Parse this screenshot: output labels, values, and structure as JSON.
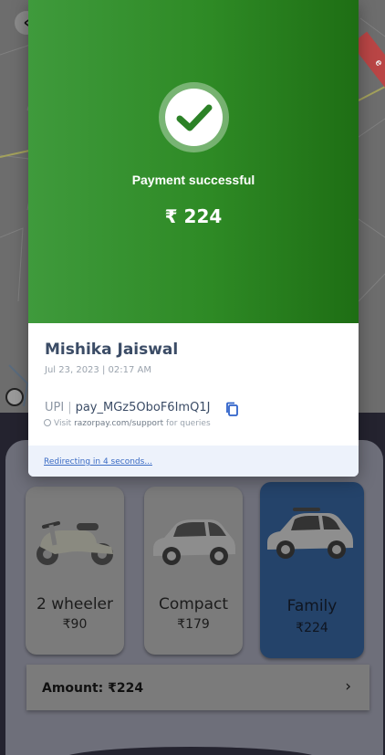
{
  "map": {
    "back_icon": "chevron-left-icon",
    "ribbon_text": "e"
  },
  "payment": {
    "status": "Payment successful",
    "amount": "₹ 224",
    "customer_name": "Mishika Jaiswal",
    "date_time": "Jul 23, 2023 | 02:17 AM",
    "upi_label": "UPI",
    "upi_id": "pay_MGz5OboF6ImQ1J",
    "support_prefix": "Visit",
    "support_link": "razorpay.com/support",
    "support_suffix": "for queries",
    "redirect_text": "Redirecting in 4 seconds...",
    "colors": {
      "success_green": "#2e8a25",
      "link_blue": "#3a6bc4"
    }
  },
  "vehicles": [
    {
      "name": "2 wheeler",
      "price": "₹90",
      "icon": "scooter-icon",
      "selected": false
    },
    {
      "name": "Compact",
      "price": "₹179",
      "icon": "compact-car-icon",
      "selected": false
    },
    {
      "name": "Family",
      "price": "₹224",
      "icon": "family-car-icon",
      "selected": true
    }
  ],
  "amount_bar": {
    "label": "Amount: ₹224",
    "chevron": "›"
  }
}
